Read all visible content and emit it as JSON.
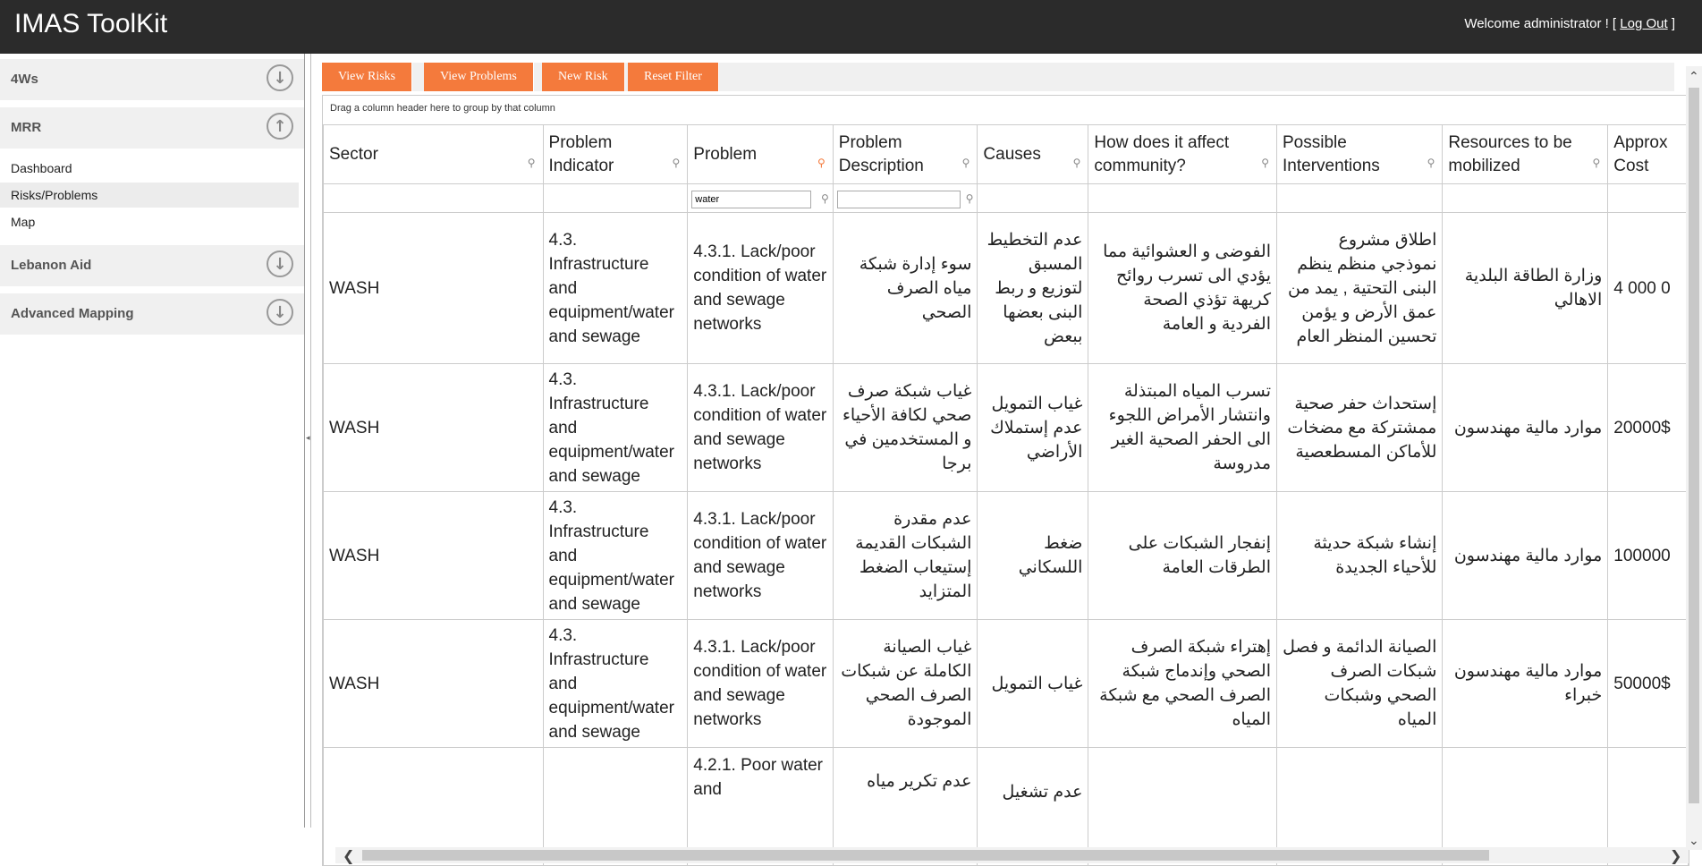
{
  "header": {
    "title": "IMAS ToolKit",
    "welcome_text": "Welcome administrator ! [",
    "logout_label": "Log Out",
    "welcome_close": "]"
  },
  "sidebar": {
    "sections": [
      {
        "label": "4Ws",
        "icon": "arrow-down-circle-icon"
      },
      {
        "label": "MRR",
        "icon": "arrow-up-circle-icon"
      },
      {
        "label": "Lebanon Aid",
        "icon": "arrow-down-circle-icon"
      },
      {
        "label": "Advanced Mapping",
        "icon": "arrow-down-circle-icon"
      }
    ],
    "mrr_items": [
      "Dashboard",
      "Risks/Problems",
      "Map"
    ],
    "active_item": "Risks/Problems"
  },
  "toolbar": {
    "view_risks": "View Risks",
    "view_problems": "View Problems",
    "new_risk": "New Risk",
    "reset_filter": "Reset Filter",
    "button_color": "#f47a3c"
  },
  "grid": {
    "group_hint": "Drag a column header here to group by that column",
    "columns": [
      "Sector",
      "Problem Indicator",
      "Problem",
      "Problem Description",
      "Causes",
      "How does it affect community?",
      "Possible Interventions",
      "Resources to be mobilized",
      "Approx Cost"
    ],
    "filter_value": "water",
    "rows": [
      {
        "sector": "WASH",
        "indicator": "4.3. Infrastructure and equipment/water and sewage",
        "problem": "4.3.1. Lack/poor condition of water and sewage networks",
        "description": "سوء إدارة شبكة مياه الصرف الصحي",
        "causes": "عدم التخطيط المسبق لتوزيع و ربط البنى بعضها ببعض",
        "affect": "الفوضى و العشوائية مما يؤدي الى تسرب روائح كريهة تؤذي الصحة الفردية و العامة",
        "interventions": "اطلاق مشروع نموذجي منظم ينظم البنى التحتية , يمد من عمق الأرض و يؤمن تحسين المنظر العام",
        "resources": "وزارة الطاقة البلدية الاهالي",
        "cost": "4 000 0"
      },
      {
        "sector": "WASH",
        "indicator": "4.3. Infrastructure and equipment/water and sewage",
        "problem": "4.3.1. Lack/poor condition of water and sewage networks",
        "description": "غياب شبكة صرف صحي لكافة الأحياء و المستخدمين في برجا",
        "causes": "غياب التمويل عدم إستملاك الأراضي",
        "affect": "تسرب المياه المبتذلة وانتشار الأمراض اللجوء الى الحفر الصحية الغير مدروسة",
        "interventions": "إستحداث حفر صحية ممشتركة مع مضخات للأماكن المسطعصية",
        "resources": "موارد مالية مهندسون",
        "cost": "20000$"
      },
      {
        "sector": "WASH",
        "indicator": "4.3. Infrastructure and equipment/water and sewage",
        "problem": "4.3.1. Lack/poor condition of water and sewage networks",
        "description": "عدم مقدرة الشبكات القديمة إستيعاب الضغط المتزايد",
        "causes": "ضغط اللسكاني",
        "affect": "إنفجار الشبكات على الطرقات العامة",
        "interventions": "إنشاء شبكة حديثة للأحياء الجديدة",
        "resources": "موارد مالية مهندسون",
        "cost": "100000"
      },
      {
        "sector": "WASH",
        "indicator": "4.3. Infrastructure and equipment/water and sewage",
        "problem": "4.3.1. Lack/poor condition of water and sewage networks",
        "description": "غياب الصيانة الكاملة عن شبكات الصرف الصحي الموجودة",
        "causes": "غياب التمويل",
        "affect": "إهتراء شبكة الصرف الصحي وإندماج شبكة الصرف الصحي مع شبكة المياه",
        "interventions": "الصيانة الدائمة و فصل شبكات الصرف الصحي وشبكات المياه",
        "resources": "موارد مالية مهندسون خبراء",
        "cost": "50000$"
      },
      {
        "sector": "",
        "indicator": "",
        "problem": "4.2.1. Poor water and",
        "description": "عدم تكرير مياه",
        "causes": "عدم تشغيل",
        "affect": "",
        "interventions": "",
        "resources": "",
        "cost": ""
      }
    ]
  }
}
